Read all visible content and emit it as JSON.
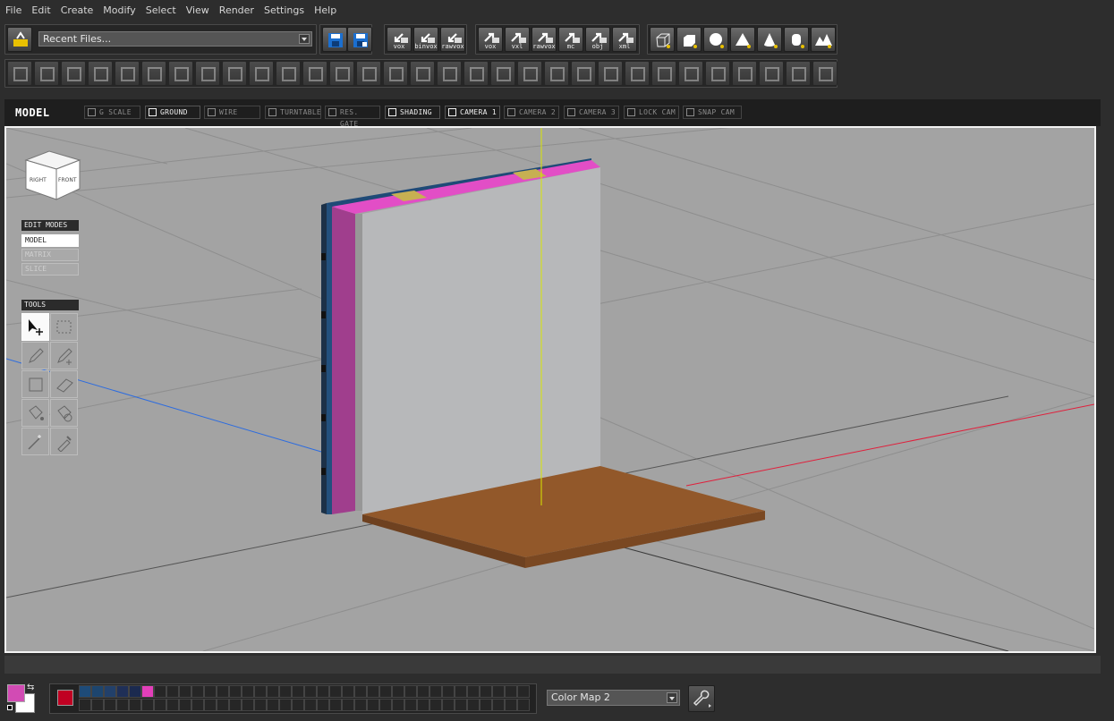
{
  "menu": [
    "File",
    "Edit",
    "Create",
    "Modify",
    "Select",
    "View",
    "Render",
    "Settings",
    "Help"
  ],
  "toolbar": {
    "recent_files": "Recent Files...",
    "import_captions": [
      "vox",
      "binvox",
      "rawvox"
    ],
    "export_captions": [
      "vox",
      "vxl",
      "rawvox",
      "mc",
      "obj",
      "xml"
    ]
  },
  "viewport": {
    "title": "MODEL",
    "tabs": [
      {
        "label": "G SCALE",
        "active": false
      },
      {
        "label": "GROUND",
        "active": true
      },
      {
        "label": "WIRE",
        "active": false
      },
      {
        "label": "TURNTABLE",
        "active": false
      },
      {
        "label": "RES. GATE",
        "active": false
      },
      {
        "label": "SHADING",
        "active": true
      },
      {
        "label": "CAMERA 1",
        "active": true
      },
      {
        "label": "CAMERA 2",
        "active": false
      },
      {
        "label": "CAMERA 3",
        "active": false
      },
      {
        "label": "LOCK CAM",
        "active": false
      },
      {
        "label": "SNAP CAM",
        "active": false
      }
    ],
    "navcube": {
      "right": "RIGHT",
      "front": "FRONT"
    }
  },
  "edit_modes": {
    "header": "EDIT MODES",
    "items": [
      "MODEL",
      "MATRIX",
      "SLICE"
    ]
  },
  "tools": {
    "header": "TOOLS",
    "icons": [
      "select-move-icon",
      "marquee-icon",
      "pencil-icon",
      "pencil-add-icon",
      "box-icon",
      "eraser-icon",
      "fill-icon",
      "fill-all-icon",
      "magic-wand-icon",
      "eyedropper-icon"
    ]
  },
  "colors": {
    "primary": "#d24bb4",
    "secondary": "#ffffff",
    "picker": "#c00022",
    "palette": [
      "#1e4b78",
      "#1d456e",
      "#22406a",
      "#1f2f57",
      "#1b2a4f",
      "#e23fb9"
    ]
  },
  "colormap": {
    "selected": "Color Map 2"
  }
}
